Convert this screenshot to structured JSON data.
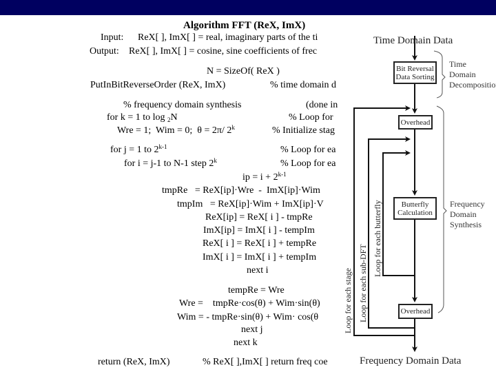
{
  "slide": {
    "title": "Algorithm FFT (ReX, ImX)",
    "input_label": "Input:",
    "input_text": "ReX[ ], ImX[ ] = real, imaginary parts of the ti",
    "output_label": "Output:",
    "output_text": "ReX[ ], ImX[ ] = cosine, sine coefficients of frec",
    "lines": {
      "n_size": "N = SizeOf( ReX )",
      "bitrev": "PutInBitReverseOrder (ReX, ImX)",
      "bitrev_comment": "% time domain d",
      "freq_comment": "% frequency domain synthesis",
      "done_in": "(done in",
      "for_k_a": "for k = 1 to log ",
      "for_k_sub": "2",
      "for_k_b": "N",
      "loop_for_1": "% Loop for",
      "init_a": "Wre = 1;  Wim = 0;  θ = 2π/ 2",
      "init_sup": "k",
      "init_comment": "% Initialize stag",
      "for_j_a": "for j = 1 to 2",
      "for_j_sup": "k-1",
      "loop_for_2": "% Loop for ea",
      "for_i_a": "for i = j-1 to N-1 step 2",
      "for_i_sup": "k",
      "loop_for_3": "% Loop for ea",
      "ip_a": "ip = i + 2",
      "ip_sup": "k-1",
      "tmpre": "tmpRe   = ReX[ip]·Wre  -  ImX[ip]·Wim",
      "tmpim": "tmpIm   = ReX[ip]·Wim + ImX[ip]·V",
      "rex_ip": "ReX[ip] = ReX[ i ] - tmpRe",
      "imx_ip": "ImX[ip] = ImX[ i ] - tempIm",
      "rex_i": "ReX[ i ] = ReX[ i ] + tempRe",
      "imx_i": "ImX[ i ] = ImX[ i ] + tempIm",
      "next_i": "next i",
      "tempre": "tempRe = Wre",
      "wre": "Wre =    tmpRe·cos(θ) + Wim·sin(θ)",
      "wim": "Wim = - tmpRe·sin(θ) + Wim· cos(θ",
      "next_j": "next j",
      "next_k": "next k",
      "return": "return (ReX, ImX)",
      "return_comment": "% ReX[ ],ImX[ ] return freq coe"
    }
  },
  "diagram": {
    "top_label": "Time Domain Data",
    "bottom_label": "Frequency Domain Data",
    "boxes": {
      "bitrev_1": "Bit Reversal",
      "bitrev_2": "Data Sorting",
      "overhead_top": "Overhead",
      "butterfly_1": "Butterfly",
      "butterfly_2": "Calculation",
      "overhead_bottom": "Overhead"
    },
    "brackets": {
      "time_1": "Time",
      "time_2": "Domain",
      "time_3": "Decomposition",
      "freq_1": "Frequency",
      "freq_2": "Domain",
      "freq_3": "Synthesis"
    },
    "loops": {
      "stage": "Loop for each stage",
      "subdft": "Loop for each sub-DFT",
      "butterfly": "Loop for each butterfly"
    }
  },
  "colors": {
    "topbar": "#000060"
  }
}
